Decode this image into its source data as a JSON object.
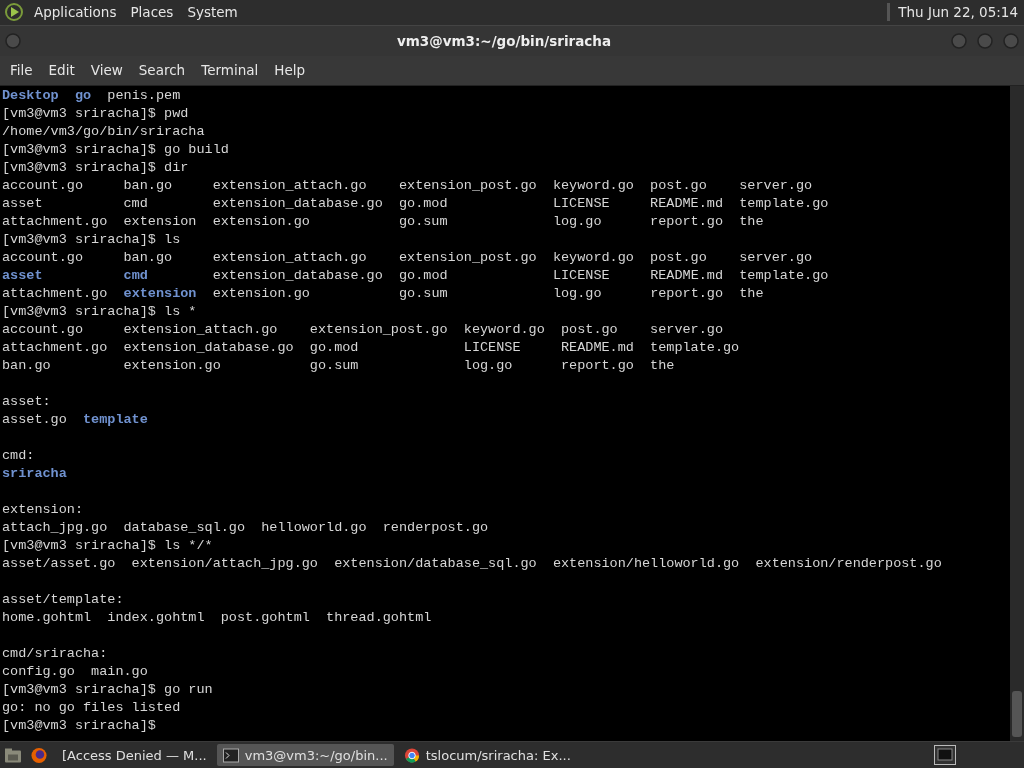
{
  "top_panel": {
    "menus": [
      "Applications",
      "Places",
      "System"
    ],
    "clock": "Thu Jun 22, 05:14"
  },
  "window": {
    "title": "vm3@vm3:~/go/bin/sriracha"
  },
  "menu_bar": [
    "File",
    "Edit",
    "View",
    "Search",
    "Terminal",
    "Help"
  ],
  "terminal": {
    "lines": [
      {
        "kind": "text",
        "segments": [
          {
            "kind": "directory",
            "text": "Desktop  "
          },
          {
            "kind": "directory",
            "text": "go"
          },
          {
            "kind": "plain",
            "text": "  penis.pem"
          }
        ]
      },
      {
        "kind": "text",
        "segments": [
          {
            "kind": "plain",
            "text": "[vm3@vm3 sriracha]$ pwd"
          }
        ]
      },
      {
        "kind": "text",
        "segments": [
          {
            "kind": "plain",
            "text": "/home/vm3/go/bin/sriracha"
          }
        ]
      },
      {
        "kind": "text",
        "segments": [
          {
            "kind": "plain",
            "text": "[vm3@vm3 sriracha]$ go build"
          }
        ]
      },
      {
        "kind": "text",
        "segments": [
          {
            "kind": "plain",
            "text": "[vm3@vm3 sriracha]$ dir"
          }
        ]
      },
      {
        "kind": "text",
        "segments": [
          {
            "kind": "plain",
            "text": "account.go     ban.go     extension_attach.go    extension_post.go  keyword.go  post.go    server.go"
          }
        ]
      },
      {
        "kind": "text",
        "segments": [
          {
            "kind": "plain",
            "text": "asset          cmd        extension_database.go  go.mod             LICENSE     README.md  template.go"
          }
        ]
      },
      {
        "kind": "text",
        "segments": [
          {
            "kind": "plain",
            "text": "attachment.go  extension  extension.go           go.sum             log.go      report.go  the"
          }
        ]
      },
      {
        "kind": "text",
        "segments": [
          {
            "kind": "plain",
            "text": "[vm3@vm3 sriracha]$ ls"
          }
        ]
      },
      {
        "kind": "text",
        "segments": [
          {
            "kind": "plain",
            "text": "account.go     ban.go     extension_attach.go    extension_post.go  keyword.go  post.go    server.go"
          }
        ]
      },
      {
        "kind": "text",
        "segments": [
          {
            "kind": "directory",
            "text": "asset          "
          },
          {
            "kind": "directory",
            "text": "cmd"
          },
          {
            "kind": "plain",
            "text": "        extension_database.go  go.mod             LICENSE     README.md  template.go"
          }
        ]
      },
      {
        "kind": "text",
        "segments": [
          {
            "kind": "plain",
            "text": "attachment.go  "
          },
          {
            "kind": "directory",
            "text": "extension"
          },
          {
            "kind": "plain",
            "text": "  extension.go           go.sum             log.go      report.go  the"
          }
        ]
      },
      {
        "kind": "text",
        "segments": [
          {
            "kind": "plain",
            "text": "[vm3@vm3 sriracha]$ ls *"
          }
        ]
      },
      {
        "kind": "text",
        "segments": [
          {
            "kind": "plain",
            "text": "account.go     extension_attach.go    extension_post.go  keyword.go  post.go    server.go"
          }
        ]
      },
      {
        "kind": "text",
        "segments": [
          {
            "kind": "plain",
            "text": "attachment.go  extension_database.go  go.mod             LICENSE     README.md  template.go"
          }
        ]
      },
      {
        "kind": "text",
        "segments": [
          {
            "kind": "plain",
            "text": "ban.go         extension.go           go.sum             log.go      report.go  the"
          }
        ]
      },
      {
        "kind": "blank"
      },
      {
        "kind": "text",
        "segments": [
          {
            "kind": "plain",
            "text": "asset:"
          }
        ]
      },
      {
        "kind": "text",
        "segments": [
          {
            "kind": "plain",
            "text": "asset.go  "
          },
          {
            "kind": "directory",
            "text": "template"
          }
        ]
      },
      {
        "kind": "blank"
      },
      {
        "kind": "text",
        "segments": [
          {
            "kind": "plain",
            "text": "cmd:"
          }
        ]
      },
      {
        "kind": "text",
        "segments": [
          {
            "kind": "directory",
            "text": "sriracha"
          }
        ]
      },
      {
        "kind": "blank"
      },
      {
        "kind": "text",
        "segments": [
          {
            "kind": "plain",
            "text": "extension:"
          }
        ]
      },
      {
        "kind": "text",
        "segments": [
          {
            "kind": "plain",
            "text": "attach_jpg.go  database_sql.go  helloworld.go  renderpost.go"
          }
        ]
      },
      {
        "kind": "text",
        "segments": [
          {
            "kind": "plain",
            "text": "[vm3@vm3 sriracha]$ ls */*"
          }
        ]
      },
      {
        "kind": "text",
        "segments": [
          {
            "kind": "plain",
            "text": "asset/asset.go  extension/attach_jpg.go  extension/database_sql.go  extension/helloworld.go  extension/renderpost.go"
          }
        ]
      },
      {
        "kind": "blank"
      },
      {
        "kind": "text",
        "segments": [
          {
            "kind": "plain",
            "text": "asset/template:"
          }
        ]
      },
      {
        "kind": "text",
        "segments": [
          {
            "kind": "plain",
            "text": "home.gohtml  index.gohtml  post.gohtml  thread.gohtml"
          }
        ]
      },
      {
        "kind": "blank"
      },
      {
        "kind": "text",
        "segments": [
          {
            "kind": "plain",
            "text": "cmd/sriracha:"
          }
        ]
      },
      {
        "kind": "text",
        "segments": [
          {
            "kind": "plain",
            "text": "config.go  main.go"
          }
        ]
      },
      {
        "kind": "text",
        "segments": [
          {
            "kind": "plain",
            "text": "[vm3@vm3 sriracha]$ go run"
          }
        ]
      },
      {
        "kind": "text",
        "segments": [
          {
            "kind": "plain",
            "text": "go: no go files listed"
          }
        ]
      },
      {
        "kind": "text",
        "segments": [
          {
            "kind": "plain",
            "text": "[vm3@vm3 sriracha]$"
          }
        ]
      }
    ]
  },
  "taskbar": {
    "tasks": [
      {
        "label": "[Access Denied — M...",
        "kind": "browser",
        "selected": false
      },
      {
        "label": "vm3@vm3:~/go/bin...",
        "kind": "terminal",
        "selected": true
      },
      {
        "label": "tslocum/sriracha: Ex...",
        "kind": "web",
        "selected": false
      }
    ]
  }
}
